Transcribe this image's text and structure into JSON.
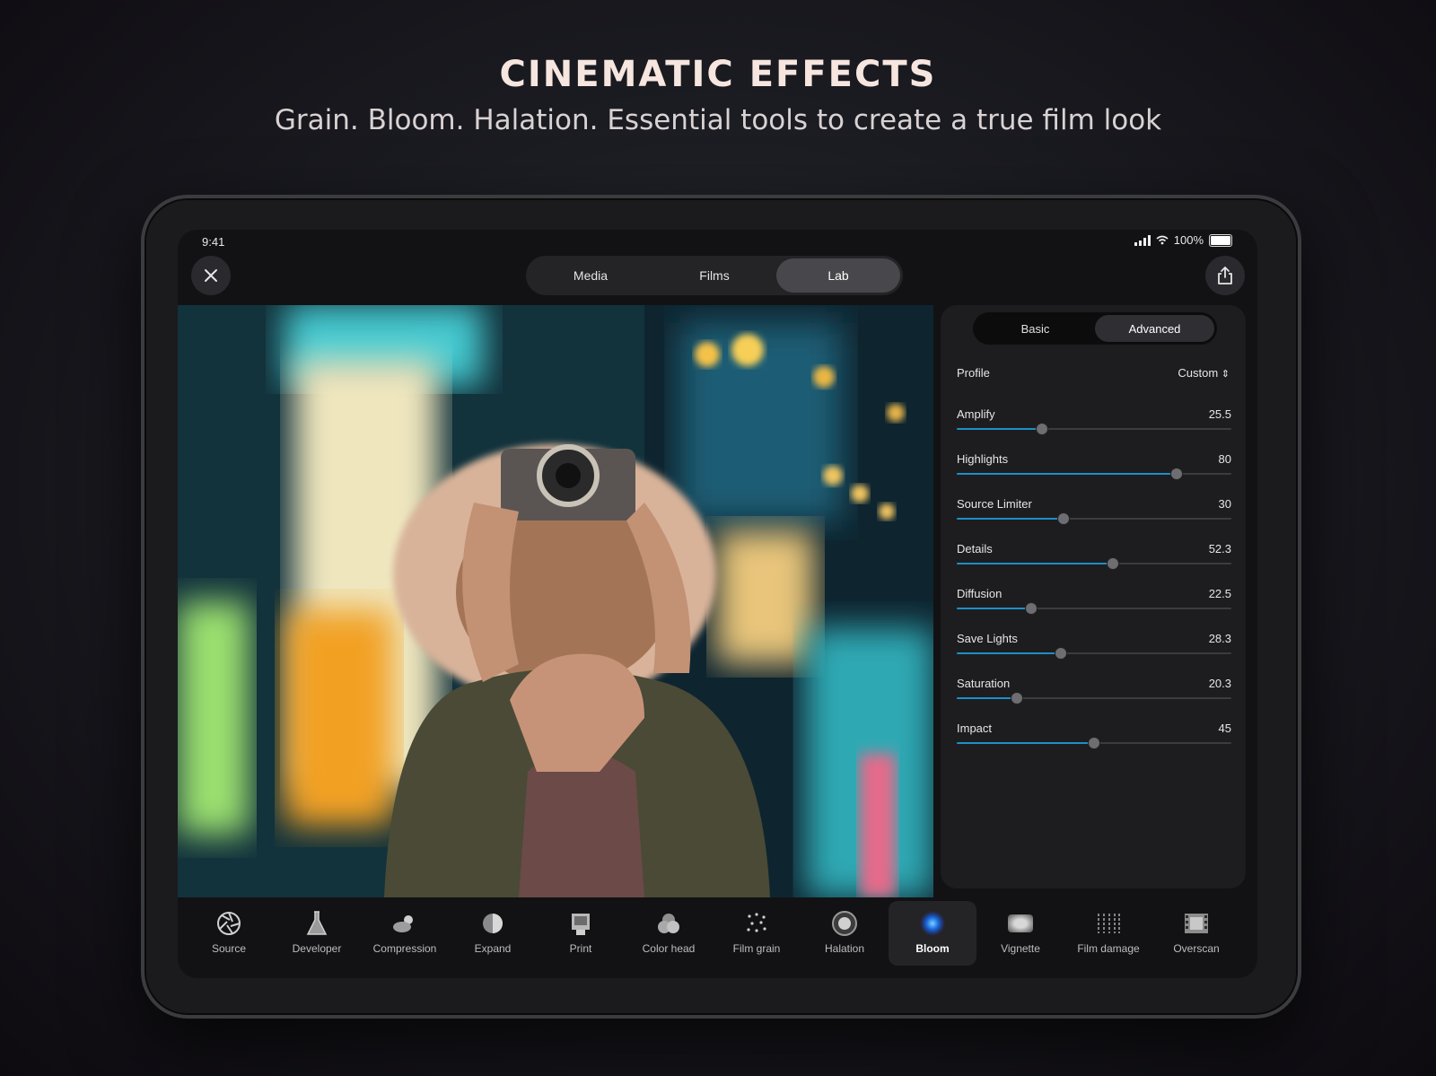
{
  "promo": {
    "headline": "CINEMATIC EFFECTS",
    "subline": "Grain. Bloom. Halation. Essential tools to create a true film look"
  },
  "status_bar": {
    "time": "9:41",
    "battery": "100%"
  },
  "top_tabs": [
    {
      "label": "Media",
      "active": false
    },
    {
      "label": "Films",
      "active": false
    },
    {
      "label": "Lab",
      "active": true
    }
  ],
  "panel": {
    "tabs": [
      {
        "label": "Basic",
        "active": false
      },
      {
        "label": "Advanced",
        "active": true
      }
    ],
    "profile": {
      "label": "Profile",
      "value": "Custom"
    },
    "sliders": [
      {
        "label": "Amplify",
        "value": "25.5",
        "fraction": 0.31
      },
      {
        "label": "Highlights",
        "value": "80",
        "fraction": 0.8
      },
      {
        "label": "Source Limiter",
        "value": "30",
        "fraction": 0.39
      },
      {
        "label": "Details",
        "value": "52.3",
        "fraction": 0.57
      },
      {
        "label": "Diffusion",
        "value": "22.5",
        "fraction": 0.27
      },
      {
        "label": "Save Lights",
        "value": "28.3",
        "fraction": 0.38
      },
      {
        "label": "Saturation",
        "value": "20.3",
        "fraction": 0.22
      },
      {
        "label": "Impact",
        "value": "45",
        "fraction": 0.5
      }
    ],
    "accent_color": "#1d8fc7"
  },
  "toolbar": [
    {
      "label": "Source",
      "icon": "aperture-icon",
      "active": false
    },
    {
      "label": "Developer",
      "icon": "flask-icon",
      "active": false
    },
    {
      "label": "Compression",
      "icon": "cloud-sun-icon",
      "active": false
    },
    {
      "label": "Expand",
      "icon": "half-circle-icon",
      "active": false
    },
    {
      "label": "Print",
      "icon": "print-icon",
      "active": false
    },
    {
      "label": "Color head",
      "icon": "color-circles-icon",
      "active": false
    },
    {
      "label": "Film grain",
      "icon": "dots-icon",
      "active": false
    },
    {
      "label": "Halation",
      "icon": "halo-icon",
      "active": false
    },
    {
      "label": "Bloom",
      "icon": "glow-icon",
      "active": true
    },
    {
      "label": "Vignette",
      "icon": "vignette-icon",
      "active": false
    },
    {
      "label": "Film damage",
      "icon": "scratches-icon",
      "active": false
    },
    {
      "label": "Overscan",
      "icon": "film-strip-icon",
      "active": false
    }
  ]
}
